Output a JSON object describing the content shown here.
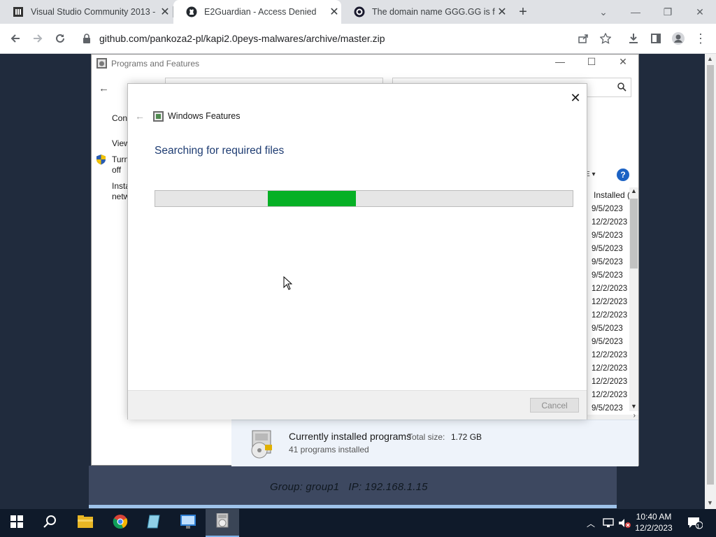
{
  "browser": {
    "tabs": [
      {
        "title": "Visual Studio Community 2013 -",
        "icon": "vs-icon"
      },
      {
        "title": "E2Guardian - Access Denied",
        "icon": "github-icon"
      },
      {
        "title": "The domain name GGG.GG is fo",
        "icon": "domain-icon"
      }
    ],
    "url": "github.com/pankoza2-pl/kapi2.0peys-malwares/archive/master.zip"
  },
  "programs_features": {
    "title": "Programs and Features",
    "left_links": [
      "Con",
      "View",
      "Turn",
      "off",
      "Insta",
      "netw"
    ],
    "column_header": "Installed (",
    "dates": [
      "9/5/2023",
      "12/2/2023",
      "9/5/2023",
      "9/5/2023",
      "9/5/2023",
      "9/5/2023",
      "12/2/2023",
      "12/2/2023",
      "12/2/2023",
      "9/5/2023",
      "9/5/2023",
      "12/2/2023",
      "12/2/2023",
      "12/2/2023",
      "12/2/2023",
      "9/5/2023"
    ],
    "footer": {
      "currently_installed": "Currently installed programs",
      "total_size_label": "Total size:",
      "total_size": "1.72 GB",
      "count_text": "41 programs installed"
    }
  },
  "windows_features": {
    "title": "Windows Features",
    "heading": "Searching for required files",
    "cancel_label": "Cancel",
    "progress_start": 0.27,
    "progress_end": 0.48,
    "progress_color": "#06b025"
  },
  "remote": {
    "group_line": "Group: group1   IP: 192.168.1.15"
  },
  "taskbar": {
    "time": "10:40 AM",
    "date": "12/2/2023",
    "notification_count": "1",
    "apps": [
      "start-icon",
      "search-icon",
      "file-explorer-icon",
      "chrome-icon",
      "notepad-icon",
      "control-panel-icon",
      "programs-features-icon"
    ]
  }
}
